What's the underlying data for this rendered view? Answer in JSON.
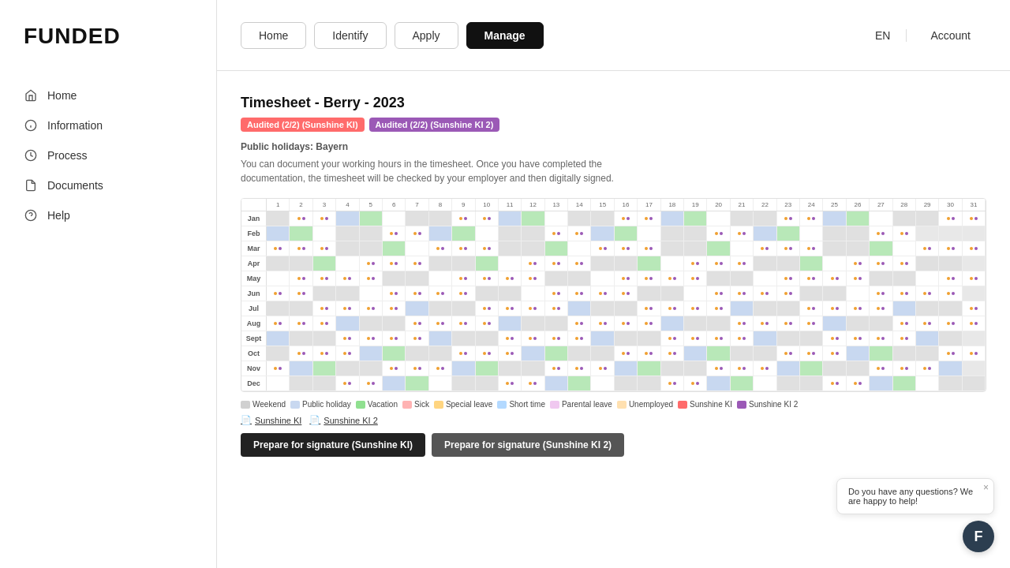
{
  "logo": "FUNDED",
  "sidebar": {
    "items": [
      {
        "label": "Home",
        "icon": "home"
      },
      {
        "label": "Information",
        "icon": "info"
      },
      {
        "label": "Process",
        "icon": "process"
      },
      {
        "label": "Documents",
        "icon": "documents"
      },
      {
        "label": "Help",
        "icon": "help"
      }
    ]
  },
  "header": {
    "nav": [
      {
        "label": "Home",
        "active": false
      },
      {
        "label": "Identify",
        "active": false
      },
      {
        "label": "Apply",
        "active": false
      },
      {
        "label": "Manage",
        "active": true
      }
    ],
    "lang": "EN",
    "account": "Account"
  },
  "page": {
    "title": "Timesheet - Berry - 2023",
    "badges": [
      {
        "label": "Audited (2/2) (Sunshine KI)",
        "color": "red"
      },
      {
        "label": "Audited (2/2) (Sunshine KI 2)",
        "color": "purple"
      }
    ],
    "public_holidays_label": "Public holidays:",
    "public_holidays_value": "Bayern",
    "description": "You can document your working hours in the timesheet. Once you have completed the documentation, the timesheet will be checked by your employer and then digitally signed.",
    "months": [
      "Jan",
      "Feb",
      "Mar",
      "Apr",
      "May",
      "Jun",
      "Jul",
      "Aug",
      "Sept",
      "Oct",
      "Nov",
      "Dec"
    ],
    "days": [
      1,
      2,
      3,
      4,
      5,
      6,
      7,
      8,
      9,
      10,
      11,
      12,
      13,
      14,
      15,
      16,
      17,
      18,
      19,
      20,
      21,
      22,
      23,
      24,
      25,
      26,
      27,
      28,
      29,
      30,
      31
    ],
    "legend": [
      {
        "label": "Weekend",
        "color": "weekend"
      },
      {
        "label": "Public holiday",
        "color": "holiday"
      },
      {
        "label": "Vacation",
        "color": "vacation"
      },
      {
        "label": "Sick",
        "color": "sick"
      },
      {
        "label": "Special leave",
        "color": "special"
      },
      {
        "label": "Short time",
        "color": "short"
      },
      {
        "label": "Parental leave",
        "color": "parental"
      },
      {
        "label": "Unemployed",
        "color": "unemployed"
      },
      {
        "label": "Sunshine KI",
        "color": "k1"
      },
      {
        "label": "Sunshine KI 2",
        "color": "k2"
      }
    ],
    "doc_links": [
      "Sunshine KI",
      "Sunshine KI 2"
    ],
    "action_buttons": [
      {
        "label": "Prepare for signature (Sunshine KI)",
        "style": "dark"
      },
      {
        "label": "Prepare for signature (Sunshine KI 2)",
        "style": "outline"
      }
    ]
  },
  "chat": {
    "avatar_letter": "F",
    "bubble_text": "Do you have any questions? We are happy to help!",
    "close_label": "×"
  }
}
